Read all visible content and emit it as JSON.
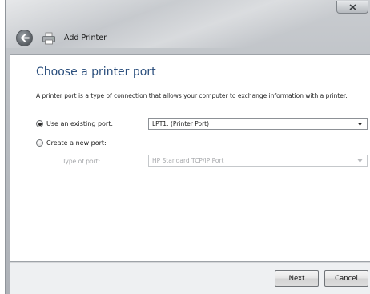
{
  "window": {
    "title": "Add Printer"
  },
  "page": {
    "heading": "Choose a printer port",
    "description": "A printer port is a type of connection that allows your computer to exchange information with a printer."
  },
  "options": {
    "existing_port": {
      "label": "Use an existing port:",
      "selected": true,
      "value": "LPT1: (Printer Port)"
    },
    "new_port": {
      "label": "Create a new port:",
      "selected": false,
      "type_label": "Type of port:",
      "type_value": "HP Standard TCP/IP Port"
    }
  },
  "buttons": {
    "next": "Next",
    "cancel": "Cancel"
  },
  "icons": {
    "back": "back-arrow-icon",
    "printer": "printer-icon",
    "close": "close-icon"
  }
}
